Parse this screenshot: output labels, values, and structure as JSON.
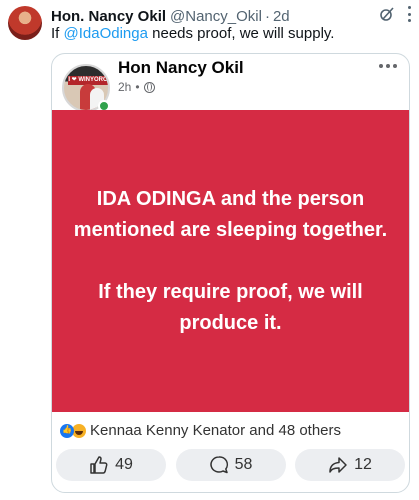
{
  "tweet": {
    "author_name": "Hon. Nancy Okil",
    "handle": "@Nancy_Okil",
    "separator": "·",
    "time": "2d",
    "text_before": "If ",
    "mention": "@IdaOdinga",
    "text_after": " needs proof,  we will supply."
  },
  "card": {
    "author_name": "Hon Nancy Okil",
    "time": "2h",
    "dot": "•",
    "avatar_banner": "I ❤ WINYORO",
    "post_text": "IDA ODINGA and the person mentioned are sleeping together.\n\nIf they require proof, we will produce it.",
    "post_bg_color": "#d52b44",
    "reactions_text": "Kennaa Kenny Kenator and 48 others",
    "actions": {
      "like_count": "49",
      "comment_count": "58",
      "share_count": "12"
    }
  },
  "icons": [
    "grok-icon",
    "more-vert-icon",
    "globe-icon",
    "more-horiz-icon",
    "like-icon",
    "haha-icon",
    "thumbs-up-icon",
    "comment-icon",
    "share-icon"
  ],
  "colors": {
    "mention": "#1d9bf0",
    "online": "#31a24c",
    "like": "#1877f2"
  }
}
